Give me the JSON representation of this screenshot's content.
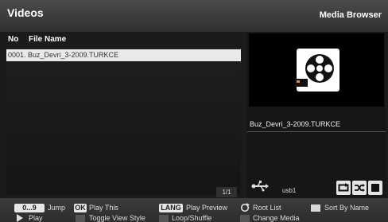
{
  "header": {
    "title": "Videos",
    "section": "Media Browser"
  },
  "columns": {
    "no": "No",
    "file_name": "File Name"
  },
  "files": [
    {
      "no": "0001.",
      "name": "Buz_Devri_3-2009.TURKCE"
    }
  ],
  "pagination": "1/1",
  "preview": {
    "file_name": "Buz_Devri_3-2009.TURKCE",
    "icon": "film-reel-icon"
  },
  "device": {
    "label": "usb1",
    "icon": "usb-icon"
  },
  "footer": {
    "jump_key": "0...9",
    "jump_label": "Jump",
    "ok_key": "OK",
    "play_this_label": "Play This",
    "lang_key": "LANG",
    "play_preview_label": "Play Preview",
    "root_list_label": "Root List",
    "sort_label": "Sort By Name",
    "play_label": "Play",
    "toggle_view_label": "Toggle View Style",
    "loop_label": "Loop/Shuffle",
    "change_media_label": "Change Media"
  },
  "colors": {
    "highlight_row": "#e9e9e9",
    "background": "#1b1b1b"
  }
}
